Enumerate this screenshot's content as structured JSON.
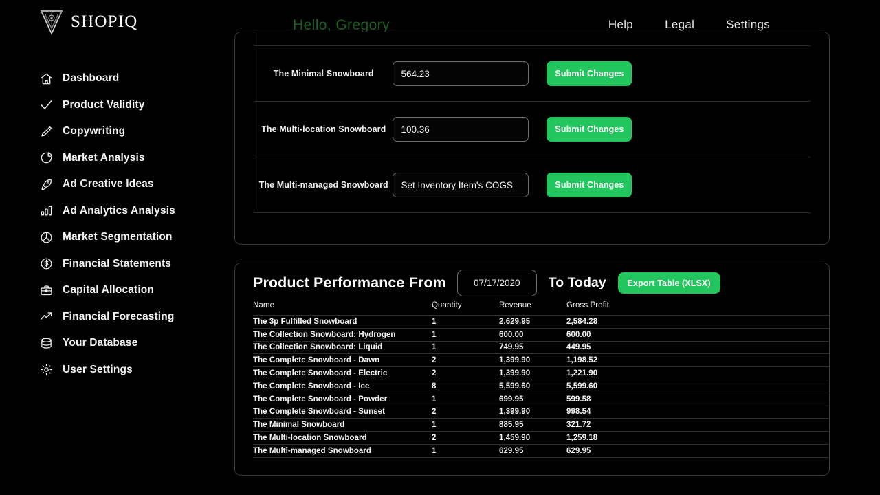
{
  "header": {
    "logo_text": "SHOPIQ",
    "logo_icon": "triangle-logo-icon",
    "greeting": "Hello, Gregory",
    "nav": [
      {
        "label": "Help",
        "name": "nav-help"
      },
      {
        "label": "Legal",
        "name": "nav-legal"
      },
      {
        "label": "Settings",
        "name": "nav-settings"
      }
    ]
  },
  "sidebar": {
    "items": [
      {
        "label": "Dashboard",
        "icon": "home-icon"
      },
      {
        "label": "Product Validity",
        "icon": "check-icon"
      },
      {
        "label": "Copywriting",
        "icon": "pencil-icon"
      },
      {
        "label": "Market Analysis",
        "icon": "pie-chart-icon"
      },
      {
        "label": "Ad Creative Ideas",
        "icon": "rocket-icon"
      },
      {
        "label": "Ad Analytics Analysis",
        "icon": "bar-chart-icon"
      },
      {
        "label": "Market Segmentation",
        "icon": "target-slice-icon"
      },
      {
        "label": "Financial Statements",
        "icon": "dollar-circle-icon"
      },
      {
        "label": "Capital Allocation",
        "icon": "briefcase-icon"
      },
      {
        "label": "Financial Forecasting",
        "icon": "trend-up-icon"
      },
      {
        "label": "Your Database",
        "icon": "database-icon"
      },
      {
        "label": "User Settings",
        "icon": "gear-icon"
      }
    ]
  },
  "cogs_card": {
    "submit_label": "Submit Changes",
    "cogs_placeholder": "Set Inventory Item's COGS",
    "rows": [
      {
        "name": "",
        "value": "",
        "partial": true
      },
      {
        "name": "The Minimal Snowboard",
        "value": "564.23",
        "partial": false
      },
      {
        "name": "The Multi-location Snowboard",
        "value": "100.36",
        "partial": false
      },
      {
        "name": "The Multi-managed Snowboard",
        "value": "",
        "partial": false
      }
    ]
  },
  "performance_card": {
    "title": "Product Performance From",
    "date_value": "07/17/2020",
    "to_label": "To Today",
    "export_label": "Export Table (XLSX)",
    "columns": [
      "Name",
      "Quantity",
      "Revenue",
      "Gross Profit"
    ],
    "rows": [
      {
        "name": "The 3p Fulfilled Snowboard",
        "quantity": "1",
        "revenue": "2,629.95",
        "gross_profit": "2,584.28"
      },
      {
        "name": "The Collection Snowboard: Hydrogen",
        "quantity": "1",
        "revenue": "600.00",
        "gross_profit": "600.00"
      },
      {
        "name": "The Collection Snowboard: Liquid",
        "quantity": "1",
        "revenue": "749.95",
        "gross_profit": "449.95"
      },
      {
        "name": "The Complete Snowboard - Dawn",
        "quantity": "2",
        "revenue": "1,399.90",
        "gross_profit": "1,198.52"
      },
      {
        "name": "The Complete Snowboard - Electric",
        "quantity": "2",
        "revenue": "1,399.90",
        "gross_profit": "1,221.90"
      },
      {
        "name": "The Complete Snowboard - Ice",
        "quantity": "8",
        "revenue": "5,599.60",
        "gross_profit": "5,599.60"
      },
      {
        "name": "The Complete Snowboard - Powder",
        "quantity": "1",
        "revenue": "699.95",
        "gross_profit": "599.58"
      },
      {
        "name": "The Complete Snowboard - Sunset",
        "quantity": "2",
        "revenue": "1,399.90",
        "gross_profit": "998.54"
      },
      {
        "name": "The Minimal Snowboard",
        "quantity": "1",
        "revenue": "885.95",
        "gross_profit": "321.72"
      },
      {
        "name": "The Multi-location Snowboard",
        "quantity": "2",
        "revenue": "1,459.90",
        "gross_profit": "1,259.18"
      },
      {
        "name": "The Multi-managed Snowboard",
        "quantity": "1",
        "revenue": "629.95",
        "gross_profit": "629.95"
      }
    ]
  },
  "colors": {
    "background": "#000000",
    "accent_green": "#22c55e",
    "greeting_green": "#1b5e20",
    "text": "#f2f2f4",
    "border": "#3a3a3a"
  }
}
